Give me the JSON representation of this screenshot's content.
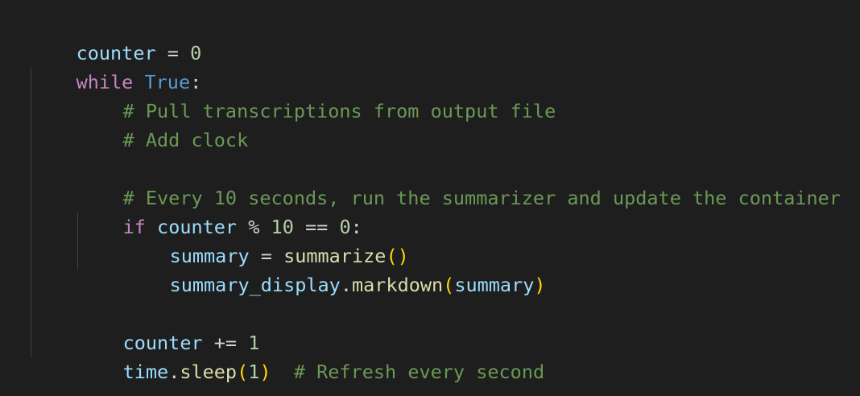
{
  "code": {
    "line1": {
      "var": "counter",
      "op": " = ",
      "num": "0"
    },
    "line2": {
      "kw": "while",
      "sp": " ",
      "const": "True",
      "colon": ":"
    },
    "line3": {
      "comment": "# Pull transcriptions from output file"
    },
    "line4": {
      "comment": "# Add clock"
    },
    "line6": {
      "comment": "# Every 10 seconds, run the summarizer and update the container"
    },
    "line7": {
      "kw": "if",
      "sp": " ",
      "var": "counter",
      "op1": " % ",
      "num1": "10",
      "op2": " == ",
      "num2": "0",
      "colon": ":"
    },
    "line8": {
      "var": "summary",
      "op": " = ",
      "fn": "summarize",
      "open": "(",
      "close": ")"
    },
    "line9": {
      "obj": "summary_display",
      "dot": ".",
      "fn": "markdown",
      "open": "(",
      "arg": "summary",
      "close": ")"
    },
    "line11": {
      "var": "counter",
      "op": " += ",
      "num": "1"
    },
    "line12": {
      "mod": "time",
      "dot": ".",
      "fn": "sleep",
      "open": "(",
      "num": "1",
      "close": ")",
      "sp": "  ",
      "comment": "# Refresh every second"
    }
  },
  "colors": {
    "background": "#1e1e1e",
    "variable": "#9cdcfe",
    "keyword": "#c586c0",
    "constant": "#569cd6",
    "number": "#b5cea8",
    "function": "#dcdcaa",
    "bracket": "#ffd700",
    "comment": "#6a9955"
  }
}
